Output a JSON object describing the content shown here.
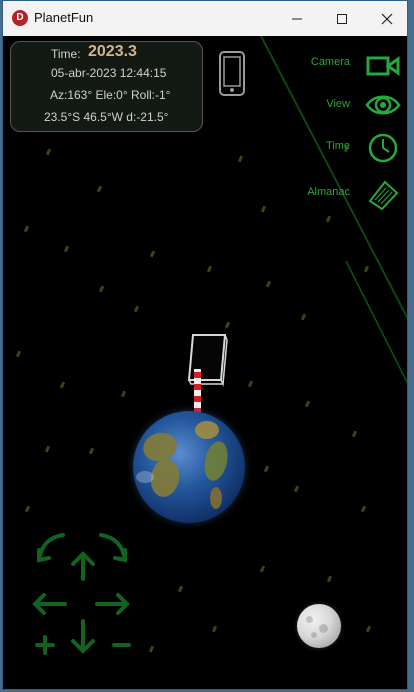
{
  "window": {
    "title": "PlanetFun"
  },
  "info": {
    "time_label": "Time:",
    "time_value": "2023.3",
    "date": "05-abr-2023 12:44:15",
    "orientation": "Az:163° Ele:0° Roll:-1°",
    "location": "23.5°S  46.5°W  d:-21.5°"
  },
  "menu": {
    "camera": "Camera",
    "view": "View",
    "time": "Time",
    "almanac": "Almanac"
  },
  "colors": {
    "accent": "#27a83b",
    "nav": "#11631f",
    "panel_border": "#555555"
  }
}
